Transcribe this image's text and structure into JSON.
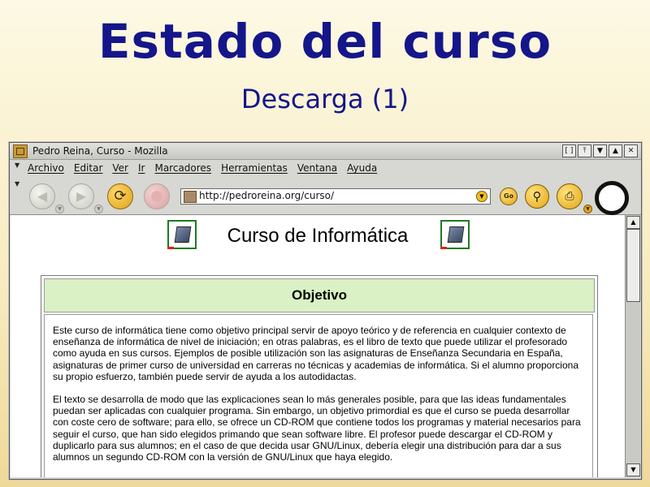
{
  "slide": {
    "title": "Estado del curso",
    "subtitle": "Descarga (1)"
  },
  "window": {
    "title": "Pedro Reina, Curso - Mozilla",
    "buttons": [
      "[ ]",
      "⤒",
      "▼",
      "▲",
      "✕"
    ]
  },
  "menu": {
    "items": [
      "Archivo",
      "Editar",
      "Ver",
      "Ir",
      "Marcadores",
      "Herramientas",
      "Ventana",
      "Ayuda"
    ]
  },
  "navbar": {
    "url": "http://pedroreina.org/curso/",
    "go_label": "Go"
  },
  "page": {
    "title": "Curso de Informática",
    "objective_heading": "Objetivo",
    "paragraph1": "Este curso de informática tiene como objetivo principal servir de apoyo teórico y de referencia en cualquier contexto de enseñanza de informática de nivel de iniciación; en otras palabras, es el libro de texto que puede utilizar el profesorado como ayuda en sus cursos. Ejemplos de posible utilización son las asignaturas de Enseñanza Secundaria en España, asignaturas de primer curso de universidad en carreras no técnicas y academias de informática. Si el alumno proporciona su propio esfuerzo, también puede servir de ayuda a los autodidactas.",
    "paragraph2": "El texto se desarrolla de modo que las explicaciones sean lo más generales posible, para que las ideas fundamentales puedan ser aplicadas con cualquier programa. Sin embargo, un objetivo primordial es que el curso se pueda desarrollar con coste cero de software; para ello, se ofrece un CD-ROM que contiene todos los programas y material necesarios para seguir el curso, que han sido elegidos primando que sean software libre. El profesor puede descargar el CD-ROM y duplicarlo para sus alumnos; en el caso de que decida usar GNU/Linux, debería elegir una distribución para dar a sus alumnos un segundo CD-ROM con la versión de GNU/Linux que haya elegido."
  },
  "icons": {
    "back": "back-arrow-icon",
    "forward": "forward-arrow-icon",
    "reload": "reload-icon",
    "stop": "stop-icon",
    "search": "magnifier-icon",
    "print": "printer-icon",
    "book": "book-icon"
  },
  "colors": {
    "slide_title": "#14168a",
    "objective_header_bg": "#d9f1c4",
    "toolbar_accent": "#e2a51a"
  }
}
